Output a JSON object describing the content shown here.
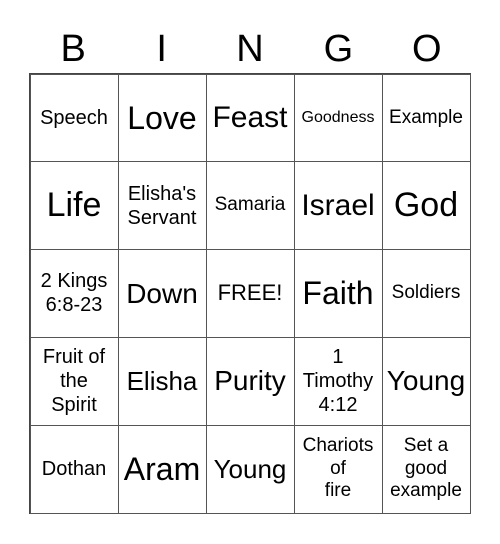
{
  "header": [
    "B",
    "I",
    "N",
    "G",
    "O"
  ],
  "cells": [
    "Speech",
    "Love",
    "Feast",
    "Goodness",
    "Example",
    "Life",
    "Elisha's\nServant",
    "Samaria",
    "Israel",
    "God",
    "2 Kings\n6:8-23",
    "Down",
    "FREE!",
    "Faith",
    "Soldiers",
    "Fruit of\nthe\nSpirit",
    "Elisha",
    "Purity",
    "1\nTimothy\n4:12",
    "Young",
    "Dothan",
    "Aram",
    "Young",
    "Chariots\nof\nfire",
    "Set a\ngood\nexample"
  ]
}
